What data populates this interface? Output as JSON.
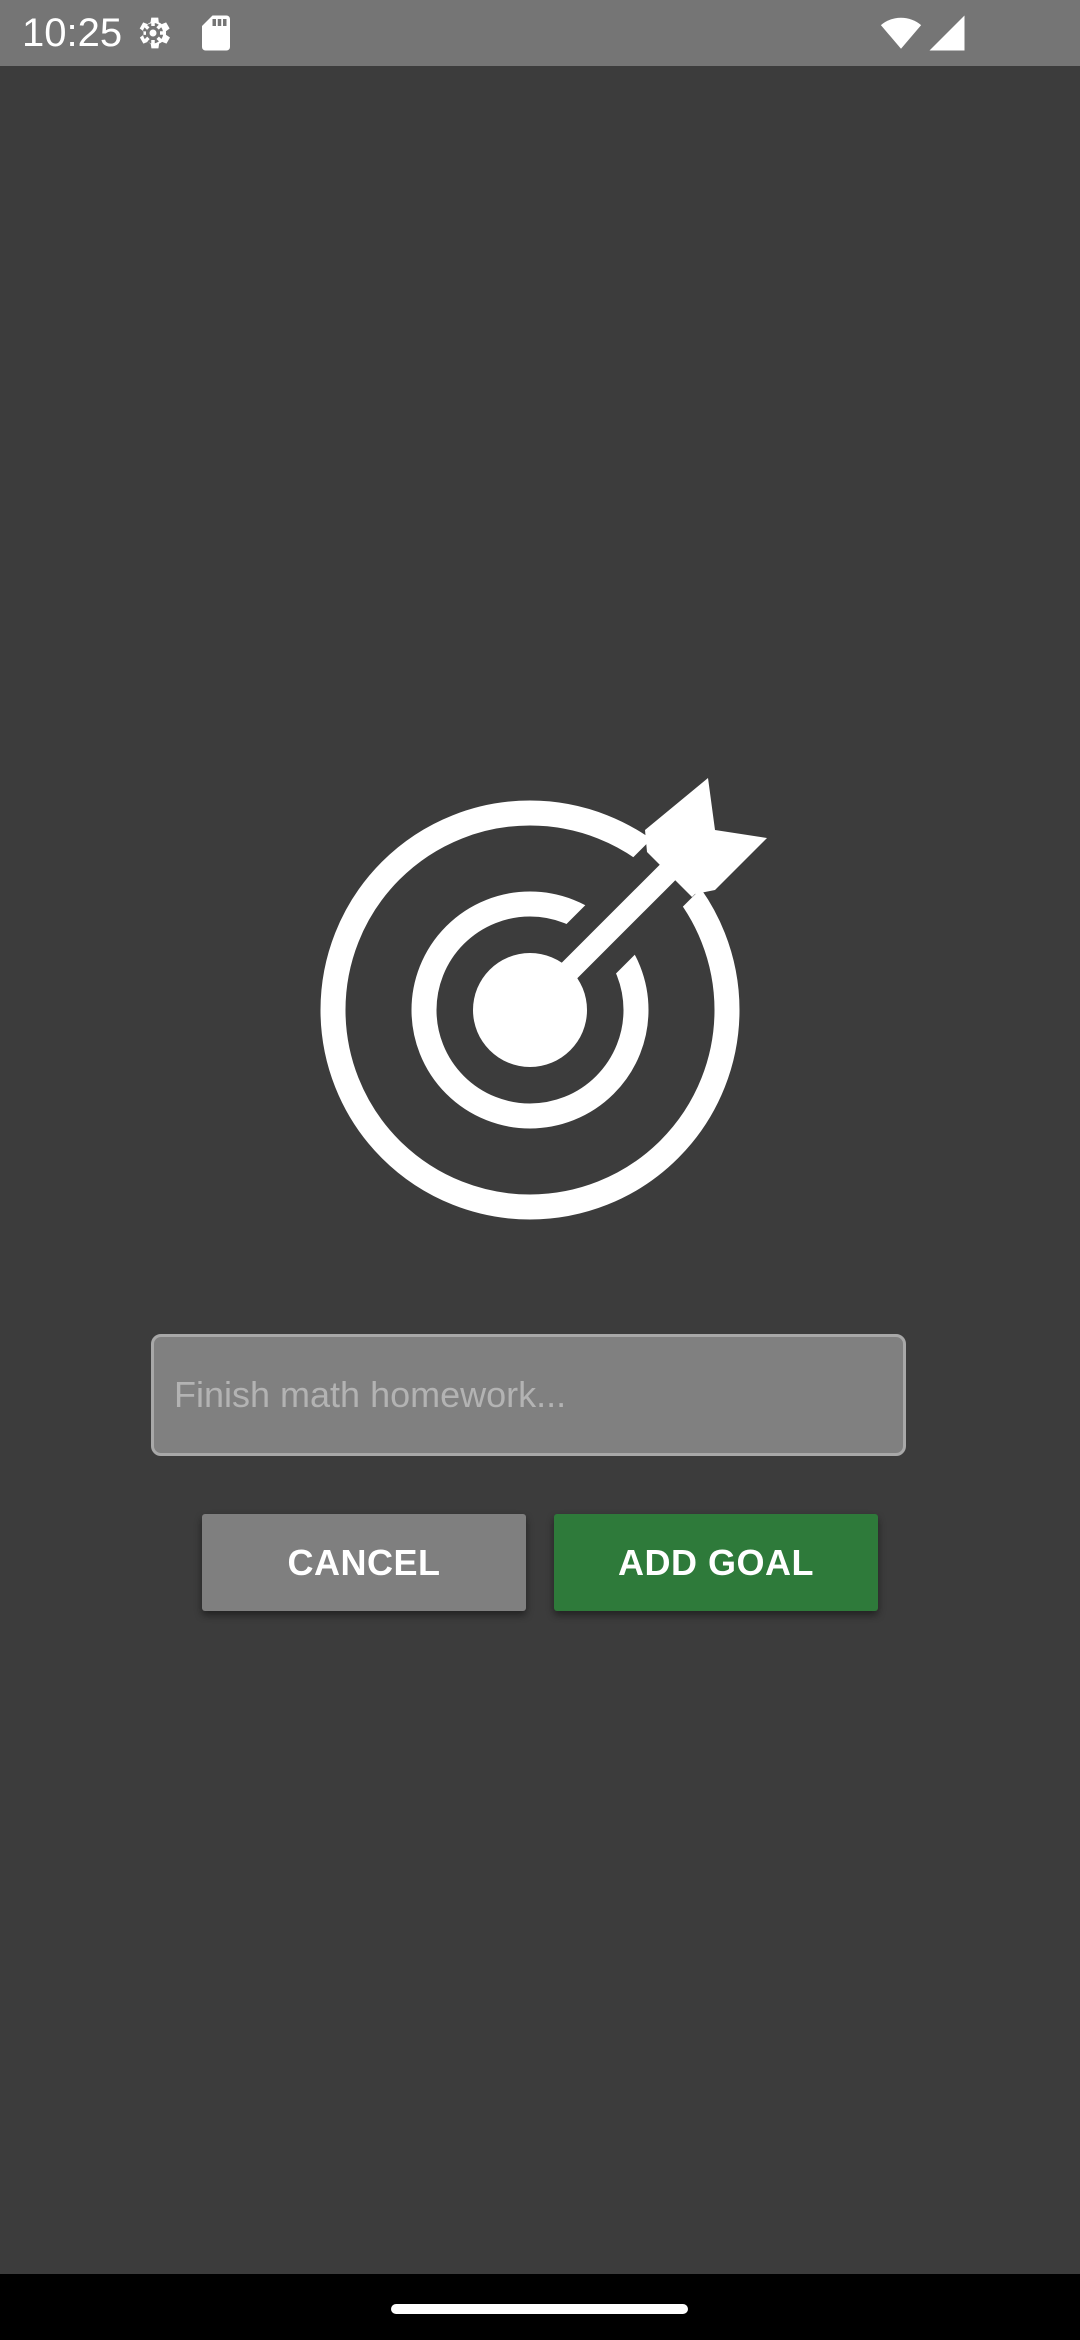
{
  "status_bar": {
    "time": "10:25",
    "icons": [
      "settings-gear-icon",
      "sd-card-icon",
      "wifi-icon",
      "cellular-signal-icon"
    ]
  },
  "main": {
    "icon": "target-arrow-icon",
    "goal_input": {
      "placeholder": "Finish math homework...",
      "value": ""
    },
    "buttons": {
      "cancel_label": "CANCEL",
      "add_label": "ADD GOAL"
    }
  },
  "colors": {
    "background": "#3c3c3c",
    "status_bar": "#757575",
    "input_background": "#808080",
    "cancel_button": "#7f7f7f",
    "add_button": "#2e7a3a",
    "nav_bar": "#000000"
  }
}
